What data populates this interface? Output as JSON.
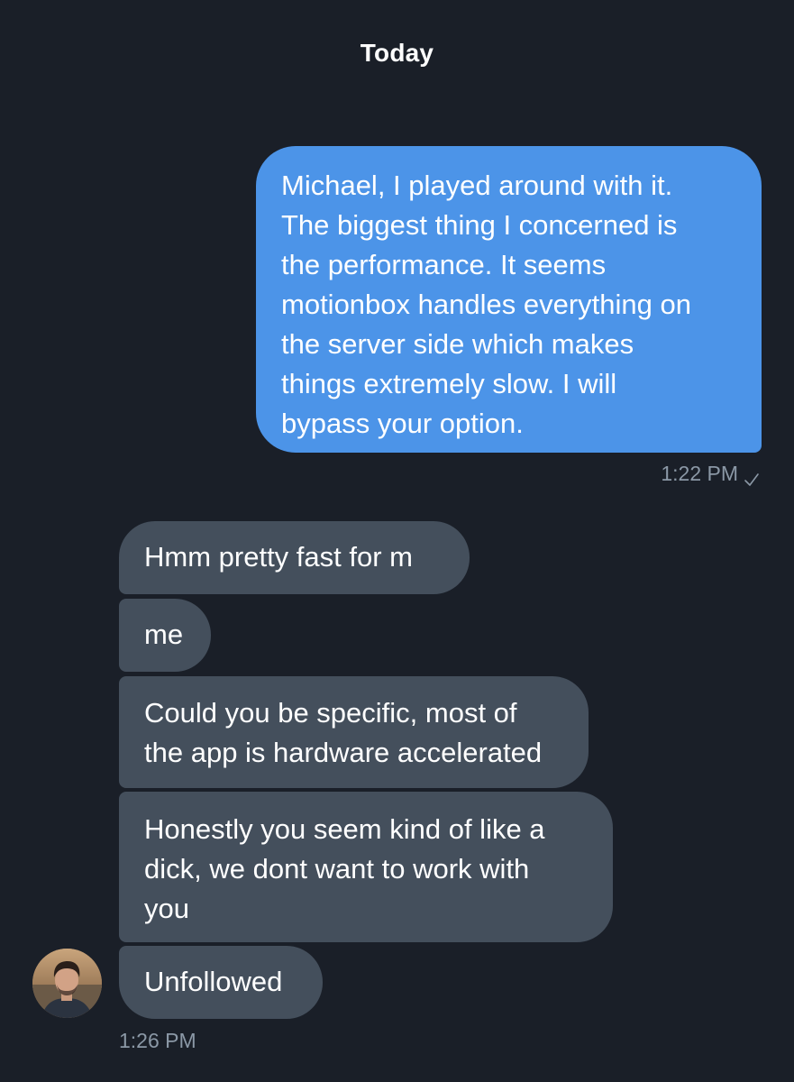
{
  "conversation": {
    "date_header": "Today",
    "outgoing": [
      {
        "text": "Michael, I played around with it.\nThe biggest thing I concerned is\nthe performance. It seems\nmotionbox handles everything on\nthe server side which makes\nthings extremely slow. I will\nbypass your option.",
        "time": "1:22 PM",
        "status_icon": "checkmark-icon"
      }
    ],
    "incoming": [
      {
        "text": "Hmm pretty fast for m"
      },
      {
        "text": "me"
      },
      {
        "text": "Could you be specific, most of\nthe app is hardware accelerated"
      },
      {
        "text": "Honestly you seem kind of like a\ndick, we dont want to work with\nyou"
      },
      {
        "text": "Unfollowed"
      }
    ],
    "incoming_time": "1:26 PM"
  },
  "colors": {
    "background": "#1a1f28",
    "outgoing_bubble": "#4c94e8",
    "incoming_bubble": "#444f5c",
    "meta_text": "#8b98a6"
  }
}
